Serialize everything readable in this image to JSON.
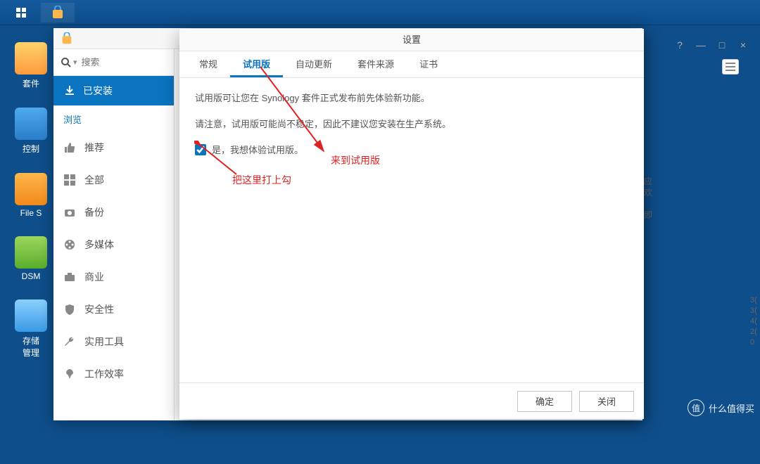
{
  "taskbar": {
    "items": [
      "menu",
      "package-center"
    ]
  },
  "desktop": {
    "icons": [
      {
        "label": "套件"
      },
      {
        "label": "控制"
      },
      {
        "label": "File S"
      },
      {
        "label": "DSM"
      },
      {
        "label": "存储\n管理"
      }
    ]
  },
  "package_center": {
    "search_placeholder": "搜索",
    "installed_label": "已安装",
    "browse_label": "浏览",
    "categories": [
      {
        "label": "推荐"
      },
      {
        "label": "全部"
      },
      {
        "label": "备份"
      },
      {
        "label": "多媒体"
      },
      {
        "label": "商业"
      },
      {
        "label": "安全性"
      },
      {
        "label": "实用工具"
      },
      {
        "label": "工作效率"
      }
    ]
  },
  "settings_dialog": {
    "title": "设置",
    "tabs": [
      {
        "label": "常规",
        "active": false
      },
      {
        "label": "试用版",
        "active": true
      },
      {
        "label": "自动更新",
        "active": false
      },
      {
        "label": "套件来源",
        "active": false
      },
      {
        "label": "证书",
        "active": false
      }
    ],
    "desc1": "试用版可让您在 Synology 套件正式发布前先体验新功能。",
    "desc2": "请注意，试用版可能尚不稳定，因此不建议您安装在生产系统。",
    "checkbox_label": "是，我想体验试用版。",
    "checkbox_checked": true,
    "ok_label": "确定",
    "close_label": "关闭"
  },
  "annotations": {
    "a1": "来到试用版",
    "a2": "把这里打上勾"
  },
  "background_window": {
    "controls": [
      "?",
      "—",
      "□",
      "×"
    ],
    "frag_right": "应\n欢\n\n即",
    "frag_nums": "3(\n3(\n4(\n2(\n0"
  },
  "watermark": {
    "text": "什么值得买",
    "badge": "值"
  }
}
